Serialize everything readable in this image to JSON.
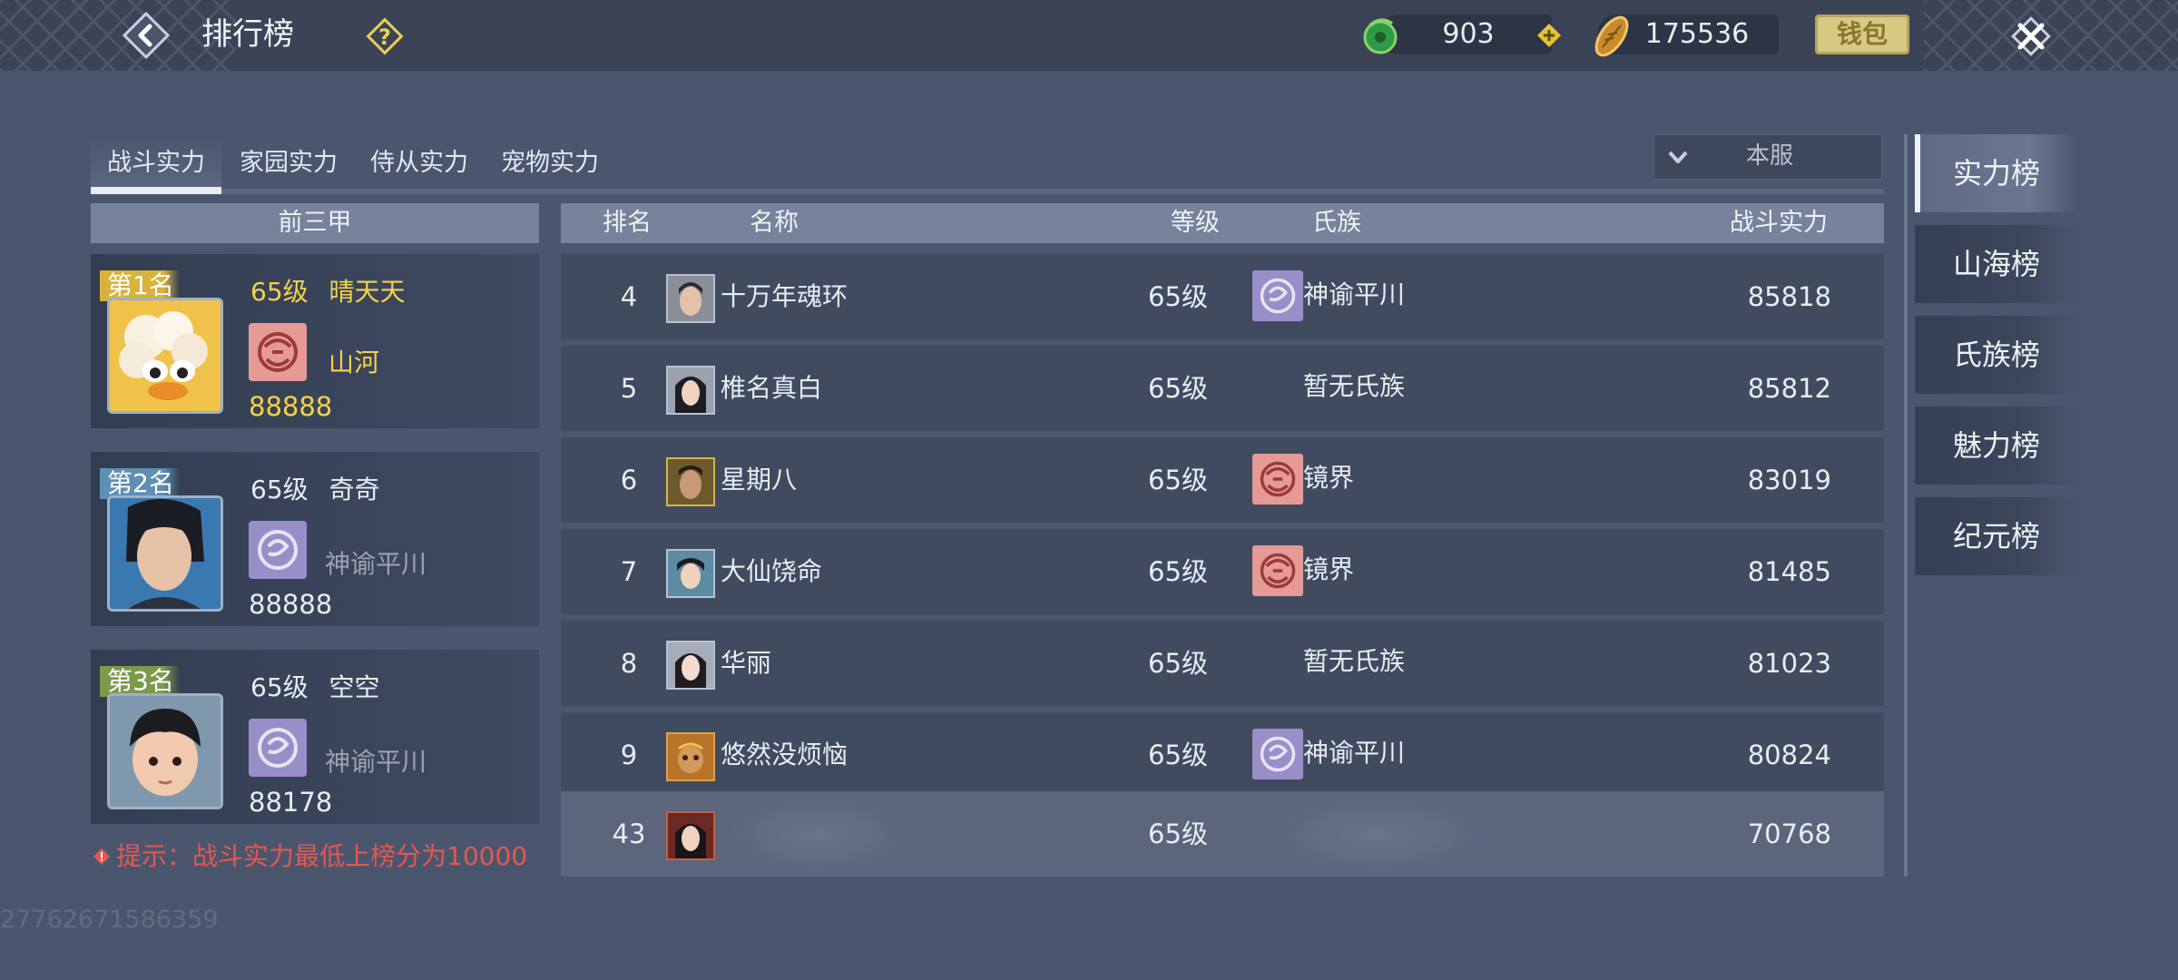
{
  "header": {
    "title": "排行榜",
    "jade": "903",
    "coins": "175536",
    "wallet_label": "钱包"
  },
  "tabs": [
    {
      "label": "战斗实力",
      "active": true
    },
    {
      "label": "家园实力",
      "active": false
    },
    {
      "label": "侍从实力",
      "active": false
    },
    {
      "label": "宠物实力",
      "active": false
    }
  ],
  "server_filter": {
    "selected": "本服"
  },
  "top3": {
    "header": "前三甲",
    "entries": [
      {
        "rank_label": "第1名",
        "level": "65级",
        "name": "晴天天",
        "clan": "山河",
        "score": "88888",
        "flag_color": "#d8b23a"
      },
      {
        "rank_label": "第2名",
        "level": "65级",
        "name": "奇奇",
        "clan": "神谕平川",
        "score": "88888",
        "flag_color": "#5e8fb4"
      },
      {
        "rank_label": "第3名",
        "level": "65级",
        "name": "空空",
        "clan": "神谕平川",
        "score": "88178",
        "flag_color": "#7c9a4c"
      }
    ],
    "hint": "提示：战斗实力最低上榜分为10000"
  },
  "table": {
    "headers": {
      "rank": "排名",
      "name": "名称",
      "level": "等级",
      "clan": "氏族",
      "power": "战斗实力"
    },
    "rows": [
      {
        "rank": "4",
        "name": "十万年魂环",
        "level": "65级",
        "clan": "神谕平川",
        "power": "85818",
        "clan_badge": "purple"
      },
      {
        "rank": "5",
        "name": "椎名真白",
        "level": "65级",
        "clan": "暂无氏族",
        "power": "85812",
        "clan_badge": "none"
      },
      {
        "rank": "6",
        "name": "星期八",
        "level": "65级",
        "clan": "镜界",
        "power": "83019",
        "clan_badge": "red"
      },
      {
        "rank": "7",
        "name": "大仙饶命",
        "level": "65级",
        "clan": "镜界",
        "power": "81485",
        "clan_badge": "red"
      },
      {
        "rank": "8",
        "name": "华丽",
        "level": "65级",
        "clan": "暂无氏族",
        "power": "81023",
        "clan_badge": "none"
      },
      {
        "rank": "9",
        "name": "悠然没烦恼",
        "level": "65级",
        "clan": "神谕平川",
        "power": "80824",
        "clan_badge": "purple"
      }
    ],
    "my_row": {
      "rank": "43",
      "level": "65级",
      "power": "70768"
    }
  },
  "side_nav": [
    "实力榜",
    "山海榜",
    "氏族榜",
    "魅力榜",
    "纪元榜"
  ],
  "uid": "27762671586359",
  "colors": {
    "accent_yellow": "#f4d24a",
    "hint_red": "#e6564f",
    "clan_purple": "#9a8ec8",
    "clan_red": "#e69a96"
  }
}
